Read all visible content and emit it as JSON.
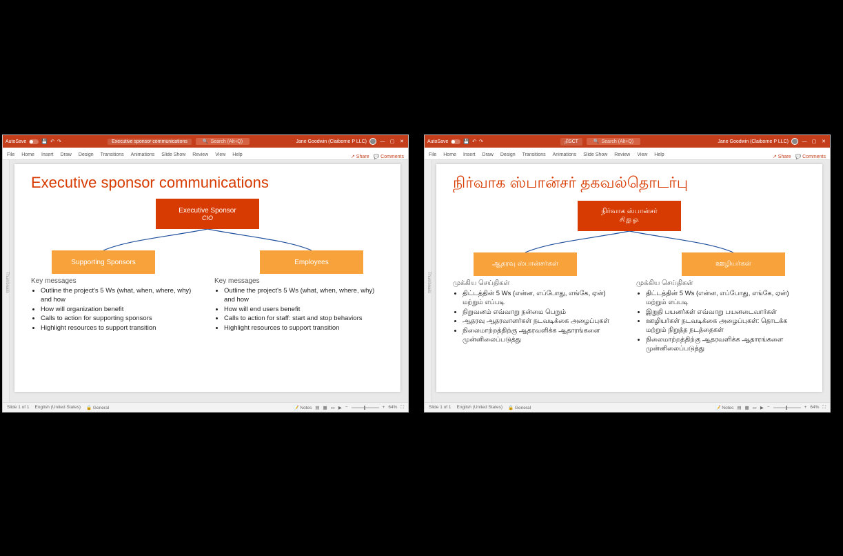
{
  "left": {
    "title_doc": "Executive sponsor communications",
    "autosave_label": "AutoSave",
    "search_placeholder": "Search (Alt+Q)",
    "user_name": "Jane Goodwin (Claiborne P LLC)",
    "ribbon_tabs": [
      "File",
      "Home",
      "Insert",
      "Draw",
      "Design",
      "Transitions",
      "Animations",
      "Slide Show",
      "Review",
      "View",
      "Help"
    ],
    "share_label": "Share",
    "comments_label": "Comments",
    "thumb_label": "Thumbnails",
    "slide_title": "Executive sponsor communications",
    "top_box_l1": "Executive Sponsor",
    "top_box_l2": "CIO",
    "child_left": "Supporting Sponsors",
    "child_right": "Employees",
    "km_left_head": "Key messages",
    "km_left": [
      "Outline the project's 5 Ws (what, when, where, why) and how",
      "How will organization benefit",
      "Calls to action for supporting sponsors",
      "Highlight resources to support transition"
    ],
    "km_right_head": "Key messages",
    "km_right": [
      "Outline the project's 5 Ws (what, when, where, why) and how",
      "How will end users benefit",
      "Calls to action for staff: start and stop behaviors",
      "Highlight resources to support transition"
    ],
    "status_slide": "Slide 1 of 1",
    "status_lang": "English (United States)",
    "status_access": "General",
    "notes_label": "Notes",
    "zoom_value": "64%"
  },
  "right": {
    "title_doc": "நிSCT",
    "autosave_label": "AutoSave",
    "search_placeholder": "Search (Alt+Q)",
    "user_name": "Jane Goodwin (Claiborne P LLC)",
    "ribbon_tabs": [
      "File",
      "Home",
      "Insert",
      "Draw",
      "Design",
      "Transitions",
      "Animations",
      "Slide Show",
      "Review",
      "View",
      "Help"
    ],
    "share_label": "Share",
    "comments_label": "Comments",
    "thumb_label": "Thumbnails",
    "slide_title": "நிர்வாக ஸ்பான்சர் தகவல்தொடர்பு",
    "top_box_l1": "நிர்வாக ஸ்பான்சர்",
    "top_box_l2": "சி.ஐ.ஓ.",
    "child_left": "ஆதரவு ஸ்பான்சர்கள்",
    "child_right": "ஊழியர்கள்",
    "km_left_head": "முக்கிய செய்திகள்",
    "km_left": [
      "திட்டத்தின் 5 Ws (என்ன, எப்போது, எங்கே, ஏன்) மற்றும் எப்படி",
      "நிறுவனம் எவ்வாறு நன்மை பெறும்",
      "ஆதரவு ஆதரவாளர்கள் நடவடிக்கை அழைப்புகள்",
      "நிலைமாற்றத்திற்கு ஆதரவளிக்க ஆதாரங்களை முன்னிலைப்படுத்து"
    ],
    "km_right_head": "முக்கிய செய்திகள்",
    "km_right": [
      "திட்டத்தின் 5 Ws (என்ன, எப்போது, எங்கே, ஏன்) மற்றும் எப்படி",
      "இறுதி பயனர்கள் எவ்வாறு பயனடைவார்கள்",
      "ஊழியர்கள் நடவடிக்கை அழைப்புகள்: தொடக்க மற்றும் நிறுத்த நடத்தைகள்",
      "நிலைமாற்றத்திற்கு ஆதரவளிக்க ஆதாரங்களை முன்னிலைப்படுத்து"
    ],
    "status_slide": "Slide 1 of 1",
    "status_lang": "English (United States)",
    "status_access": "General",
    "notes_label": "Notes",
    "zoom_value": "64%"
  }
}
